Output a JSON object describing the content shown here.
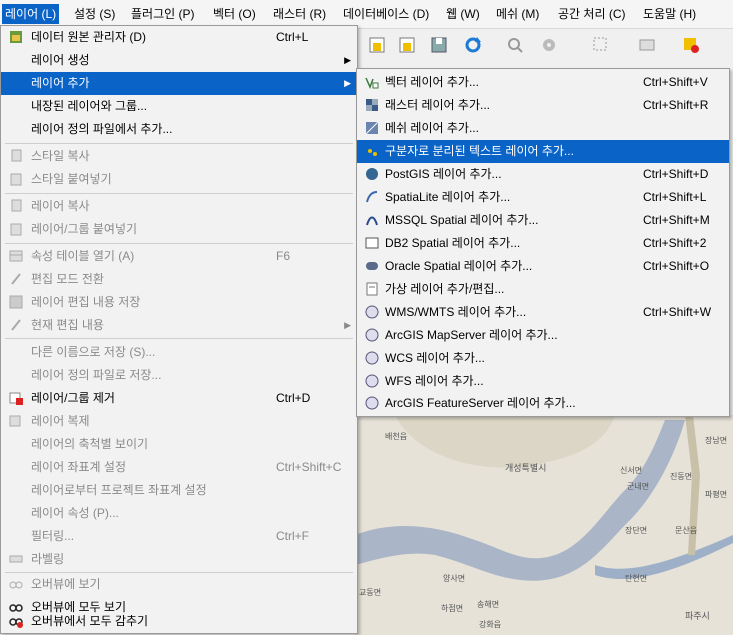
{
  "menubar": [
    "레이어 (L)",
    "설정 (S)",
    "플러그인 (P)",
    "벡터 (O)",
    "래스터 (R)",
    "데이터베이스 (D)",
    "웹 (W)",
    "메쉬 (M)",
    "공간 처리 (C)",
    "도움말 (H)"
  ],
  "layer_menu": {
    "items": [
      {
        "label": "데이터 원본 관리자 (D)",
        "shortcut": "Ctrl+L",
        "icon": "data-source-manager-icon"
      },
      {
        "label": "레이어 생성",
        "icon": ""
      },
      {
        "label": "레이어 추가",
        "icon": ""
      },
      {
        "label": "내장된 레이어와 그룹...",
        "icon": ""
      },
      {
        "label": "레이어 정의 파일에서 추가...",
        "icon": ""
      },
      {
        "label": "스타일 복사",
        "icon": "copy-style-icon"
      },
      {
        "label": "스타일 붙여넣기",
        "icon": "paste-style-icon"
      },
      {
        "label": "레이어 복사",
        "icon": "copy-layer-icon"
      },
      {
        "label": "레이어/그룹 붙여넣기",
        "icon": "paste-layer-icon"
      },
      {
        "label": "속성 테이블 열기 (A)",
        "shortcut": "F6",
        "icon": "attribute-table-icon"
      },
      {
        "label": "편집 모드 전환",
        "icon": "pencil-icon"
      },
      {
        "label": "레이어 편집 내용 저장",
        "icon": "save-edits-icon"
      },
      {
        "label": "현재 편집 내용",
        "icon": "current-edits-icon"
      },
      {
        "label": "다른 이름으로 저장 (S)...",
        "icon": ""
      },
      {
        "label": "레이어 정의 파일로 저장...",
        "icon": ""
      },
      {
        "label": "레이어/그룹 제거",
        "shortcut": "Ctrl+D",
        "icon": "remove-layer-icon"
      },
      {
        "label": "레이어 복제",
        "icon": "duplicate-layer-icon"
      },
      {
        "label": "레이어의 축척별 보이기",
        "icon": ""
      },
      {
        "label": "레이어 좌표계 설정",
        "shortcut": "Ctrl+Shift+C",
        "icon": ""
      },
      {
        "label": "레이어로부터 프로젝트 좌표계 설정",
        "icon": ""
      },
      {
        "label": "레이어 속성 (P)...",
        "icon": ""
      },
      {
        "label": "필터링...",
        "shortcut": "Ctrl+F",
        "icon": ""
      },
      {
        "label": "라벨링",
        "icon": "labeling-icon"
      },
      {
        "label": "오버뷰에 보기",
        "icon": "overview-icon"
      },
      {
        "label": "오버뷰에 모두 보기",
        "icon": "overview-all-icon"
      },
      {
        "label": "오버뷰에서 모두 감추기",
        "icon": "overview-hide-icon"
      }
    ]
  },
  "add_layer_submenu": {
    "items": [
      {
        "label": "벡터 레이어 추가...",
        "shortcut": "Ctrl+Shift+V",
        "icon": "vector-layer-icon"
      },
      {
        "label": "래스터 레이어 추가...",
        "shortcut": "Ctrl+Shift+R",
        "icon": "raster-layer-icon"
      },
      {
        "label": "메쉬 레이어 추가...",
        "shortcut": "",
        "icon": "mesh-layer-icon"
      },
      {
        "label": "구분자로 분리된 텍스트 레이어 추가...",
        "shortcut": "",
        "icon": "delimited-text-icon"
      },
      {
        "label": "PostGIS 레이어 추가...",
        "shortcut": "Ctrl+Shift+D",
        "icon": "postgis-icon"
      },
      {
        "label": "SpatiaLite 레이어 추가...",
        "shortcut": "Ctrl+Shift+L",
        "icon": "spatialite-icon"
      },
      {
        "label": "MSSQL Spatial 레이어 추가...",
        "shortcut": "Ctrl+Shift+M",
        "icon": "mssql-icon"
      },
      {
        "label": "DB2 Spatial 레이어 추가...",
        "shortcut": "Ctrl+Shift+2",
        "icon": "db2-icon"
      },
      {
        "label": "Oracle Spatial 레이어 추가...",
        "shortcut": "Ctrl+Shift+O",
        "icon": "oracle-icon"
      },
      {
        "label": "가상 레이어 추가/편집...",
        "shortcut": "",
        "icon": "virtual-layer-icon"
      },
      {
        "label": "WMS/WMTS 레이어 추가...",
        "shortcut": "Ctrl+Shift+W",
        "icon": "wms-icon"
      },
      {
        "label": "ArcGIS MapServer 레이어 추가...",
        "shortcut": "",
        "icon": "arcgis-mapserver-icon"
      },
      {
        "label": "WCS 레이어 추가...",
        "shortcut": "",
        "icon": "wcs-icon"
      },
      {
        "label": "WFS 레이어 추가...",
        "shortcut": "",
        "icon": "wfs-icon"
      },
      {
        "label": "ArcGIS FeatureServer 레이어 추가...",
        "shortcut": "",
        "icon": "arcgis-featureserver-icon"
      }
    ]
  },
  "map_labels": [
    "배천읍",
    "개성특별시",
    "신서면",
    "진동면",
    "장남면",
    "군내면",
    "파평면",
    "장단면",
    "문산읍",
    "탄현면",
    "파주시",
    "양사면",
    "하점면",
    "송해면",
    "교동면",
    "강화읍"
  ],
  "colors": {
    "highlight": "#0a64c8",
    "menu_bg": "#f2f2f2",
    "disabled": "#8a8a8a"
  }
}
